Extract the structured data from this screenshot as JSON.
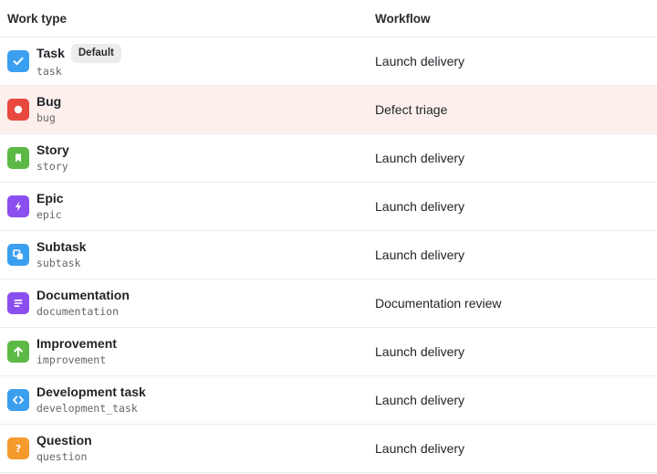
{
  "header": {
    "work_type": "Work type",
    "workflow": "Workflow"
  },
  "rows": [
    {
      "name": "Task",
      "key": "task",
      "badge": "Default",
      "workflow": "Launch delivery",
      "icon": "checkmark-icon",
      "color": "#3b9ff0"
    },
    {
      "name": "Bug",
      "key": "bug",
      "workflow": "Defect triage",
      "icon": "bug-icon",
      "color": "#e9483f"
    },
    {
      "name": "Story",
      "key": "story",
      "workflow": "Launch delivery",
      "icon": "bookmark-icon",
      "color": "#5cb946"
    },
    {
      "name": "Epic",
      "key": "epic",
      "workflow": "Launch delivery",
      "icon": "lightning-icon",
      "color": "#8b4ff0"
    },
    {
      "name": "Subtask",
      "key": "subtask",
      "workflow": "Launch delivery",
      "icon": "subtask-icon",
      "color": "#3b9ff0"
    },
    {
      "name": "Documentation",
      "key": "documentation",
      "workflow": "Documentation review",
      "icon": "document-lines-icon",
      "color": "#8b4ff0"
    },
    {
      "name": "Improvement",
      "key": "improvement",
      "workflow": "Launch delivery",
      "icon": "arrow-up-icon",
      "color": "#5cb946"
    },
    {
      "name": "Development task",
      "key": "development_task",
      "workflow": "Launch delivery",
      "icon": "code-brackets-icon",
      "color": "#3b9ff0"
    },
    {
      "name": "Question",
      "key": "question",
      "workflow": "Launch delivery",
      "icon": "question-icon",
      "color": "#f59a2e"
    }
  ],
  "highlight_color": "#fdf0ec"
}
